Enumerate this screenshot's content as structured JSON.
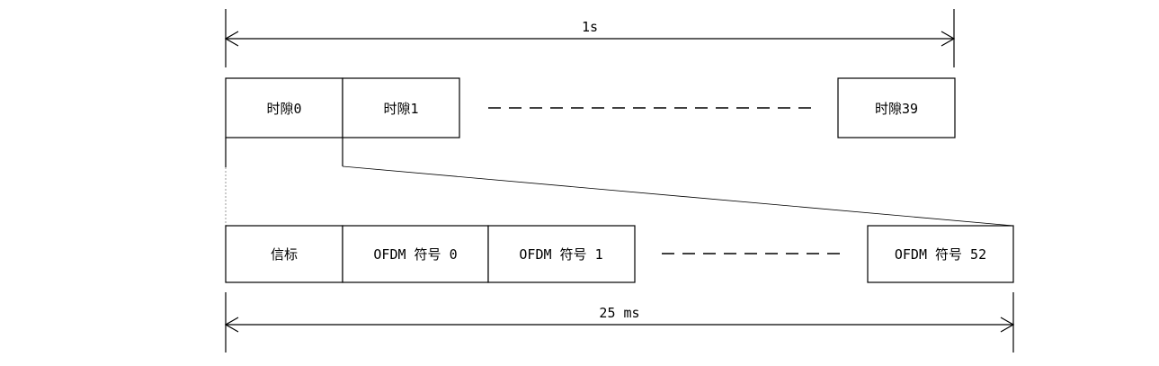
{
  "frame": {
    "duration_label": "1s",
    "slots": [
      {
        "label": "时隙0"
      },
      {
        "label": "时隙1"
      },
      {
        "label": "时隙39"
      }
    ]
  },
  "slot": {
    "duration_label": "25 ms",
    "fields": [
      {
        "label": "信标"
      },
      {
        "label": "OFDM 符号 0"
      },
      {
        "label": "OFDM 符号 1"
      },
      {
        "label": "OFDM 符号 52"
      }
    ]
  }
}
